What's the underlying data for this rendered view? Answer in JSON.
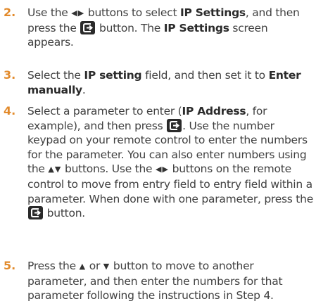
{
  "steps": [
    {
      "number": "2.",
      "parts": [
        "Use the ",
        " buttons to select ",
        "IP Settings",
        ", and then press the ",
        " button. The ",
        "IP Settings",
        " screen appears."
      ]
    },
    {
      "number": "3.",
      "parts": [
        "Select the ",
        "IP setting",
        " field, and then set it to ",
        "Enter manually",
        "."
      ]
    },
    {
      "number": "4.",
      "parts": [
        "Select a parameter to enter (",
        "IP Address",
        ", for example), and then press ",
        ". Use the number keypad on your remote control to enter the numbers for the parameter. You can also enter numbers using the ",
        " buttons. Use the ",
        " buttons on the remote control to move from entry field to entry field within a parameter. When done with one parameter, press the ",
        " button."
      ]
    },
    {
      "number": "5.",
      "parts": [
        "Press the ",
        " or ",
        " button to move to another parameter, and then enter the numbers for that parameter following the instructions in Step 4."
      ]
    }
  ],
  "icons": {
    "left_right": "left-right-arrows-icon",
    "up_down": "up-down-arrows-icon",
    "up": "up-arrow-icon",
    "down": "down-arrow-icon",
    "enter": "enter-button-icon"
  }
}
